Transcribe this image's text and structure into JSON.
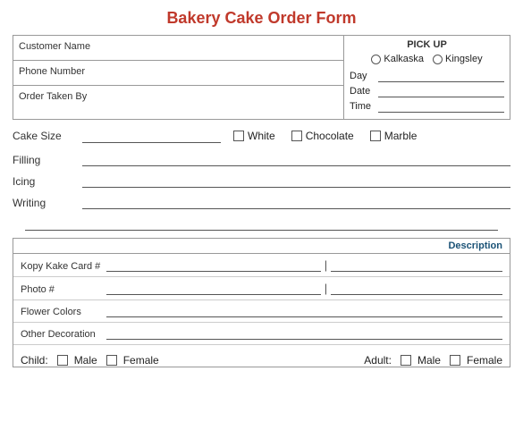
{
  "title": "Bakery Cake Order Form",
  "top_section": {
    "customer_name_label": "Customer Name",
    "phone_number_label": "Phone Number",
    "order_taken_by_label": "Order Taken By",
    "pickup_title": "PICK UP",
    "location1": "Kalkaska",
    "location2": "Kingsley",
    "day_label": "Day",
    "date_label": "Date",
    "time_label": "Time"
  },
  "cake_size_label": "Cake Size",
  "checkboxes": {
    "white": "White",
    "chocolate": "Chocolate",
    "marble": "Marble"
  },
  "fields": {
    "filling_label": "Filling",
    "icing_label": "Icing",
    "writing_label": "Writing"
  },
  "desc_section": {
    "header": "Description",
    "kopy_kake_label": "Kopy Kake Card #",
    "photo_label": "Photo #",
    "flower_colors_label": "Flower Colors",
    "other_deco_label": "Other Decoration"
  },
  "bottom": {
    "child_label": "Child:",
    "male_label": "Male",
    "female_label": "Female",
    "adult_label": "Adult:",
    "adult_male_label": "Male",
    "adult_female_label": "Female"
  }
}
